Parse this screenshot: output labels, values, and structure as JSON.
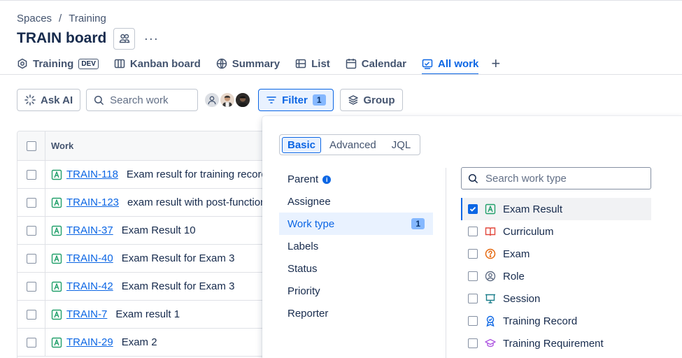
{
  "breadcrumb": {
    "spaces": "Spaces",
    "separator": "/",
    "project": "Training"
  },
  "page": {
    "title": "TRAIN board",
    "more": "···"
  },
  "tabs": [
    {
      "label": "Training",
      "badge": "DEV",
      "icon": "project-settings-icon"
    },
    {
      "label": "Kanban board",
      "icon": "board-icon"
    },
    {
      "label": "Summary",
      "icon": "globe-icon"
    },
    {
      "label": "List",
      "icon": "list-icon"
    },
    {
      "label": "Calendar",
      "icon": "calendar-icon"
    },
    {
      "label": "All work",
      "icon": "all-work-icon",
      "active": true
    }
  ],
  "tab_add": "+",
  "toolbar": {
    "ask_ai": "Ask AI",
    "search_placeholder": "Search work",
    "filter_label": "Filter",
    "filter_count": "1",
    "group_label": "Group"
  },
  "table": {
    "header_work": "Work",
    "rows": [
      {
        "key": "TRAIN-118",
        "summary": "Exam result for training record"
      },
      {
        "key": "TRAIN-123",
        "summary": "exam result with post-function"
      },
      {
        "key": "TRAIN-37",
        "summary": "Exam Result 10"
      },
      {
        "key": "TRAIN-40",
        "summary": "Exam Result for Exam 3"
      },
      {
        "key": "TRAIN-42",
        "summary": "Exam Result for Exam 3"
      },
      {
        "key": "TRAIN-7",
        "summary": "Exam result 1"
      },
      {
        "key": "TRAIN-29",
        "summary": "Exam 2"
      }
    ]
  },
  "filter_popup": {
    "modes": [
      "Basic",
      "Advanced",
      "JQL"
    ],
    "fields": [
      {
        "label": "Parent",
        "info": "i"
      },
      {
        "label": "Assignee"
      },
      {
        "label": "Work type",
        "count": "1",
        "active": true
      },
      {
        "label": "Labels"
      },
      {
        "label": "Status"
      },
      {
        "label": "Priority"
      },
      {
        "label": "Reporter"
      }
    ],
    "type_search_placeholder": "Search work type",
    "work_types": [
      {
        "label": "Exam Result",
        "checked": true,
        "icon": "exam-result-icon",
        "color": "#22a06b"
      },
      {
        "label": "Curriculum",
        "checked": false,
        "icon": "book-icon",
        "color": "#e2483d"
      },
      {
        "label": "Exam",
        "checked": false,
        "icon": "question-icon",
        "color": "#e56910"
      },
      {
        "label": "Role",
        "checked": false,
        "icon": "person-icon",
        "color": "#626f86"
      },
      {
        "label": "Session",
        "checked": false,
        "icon": "presentation-icon",
        "color": "#1d7f8c"
      },
      {
        "label": "Training Record",
        "checked": false,
        "icon": "award-icon",
        "color": "#0c66e4"
      },
      {
        "label": "Training Requirement",
        "checked": false,
        "icon": "graduation-cap-icon",
        "color": "#af59e1"
      }
    ]
  }
}
